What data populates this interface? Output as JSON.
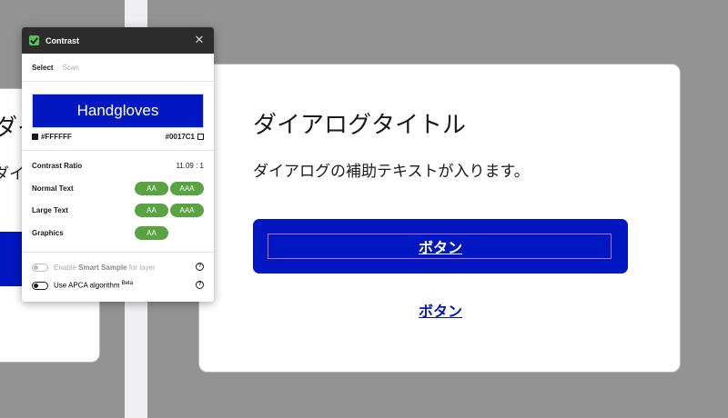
{
  "background_dialog": {
    "title": "ダイアログタイトル",
    "subtitle": "ダイアログの補助テキストが入ります。"
  },
  "dialog": {
    "title": "ダイアログタイトル",
    "subtitle": "ダイアログの補助テキストが入ります。",
    "primary_button_label": "ボタン",
    "link_button_label": "ボタン"
  },
  "plugin": {
    "title": "Contrast",
    "close_icon": "close-icon",
    "tabs": [
      {
        "label": "Select",
        "active": true
      },
      {
        "label": "Scan",
        "active": false
      }
    ],
    "preview_text": "Handgloves",
    "foreground_hex": "#FFFFFF",
    "background_hex": "#0017C1",
    "contrast_ratio_label": "Contrast Ratio",
    "contrast_ratio_value": "11.09 : 1",
    "checks": [
      {
        "label": "Normal Text",
        "badges": [
          "AA",
          "AAA"
        ]
      },
      {
        "label": "Large Text",
        "badges": [
          "AA",
          "AAA"
        ]
      },
      {
        "label": "Graphics",
        "badges": [
          "AA"
        ]
      }
    ],
    "smart_sample": {
      "prefix": "Enable ",
      "bold": "Smart Sample",
      "suffix": " for layer",
      "enabled": false
    },
    "apca": {
      "label": "Use APCA algorithm",
      "tag": "Beta",
      "enabled": false
    }
  },
  "colors": {
    "brand_blue": "#0017C1",
    "pass_green": "#59A343",
    "panel_header": "#2C2C2C"
  }
}
